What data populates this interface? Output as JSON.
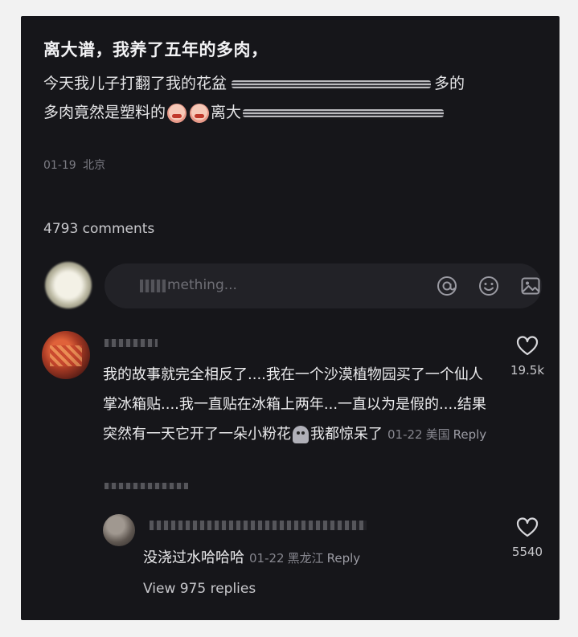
{
  "post": {
    "title": "离大谱，我养了五年的多肉，",
    "body_part1": "今天我儿子打翻了我的花盆",
    "body_part2": "多的",
    "body_part3": "多肉竟然是塑料的",
    "body_part4": "离大",
    "date": "01-19",
    "location": "北京"
  },
  "comments_count": "4793 comments",
  "input": {
    "placeholder_visible": "mething..."
  },
  "comments": [
    {
      "text": "我的故事就完全相反了....我在一个沙漠植物园买了一个仙人掌冰箱贴....我一直贴在冰箱上两年...一直以为是假的....结果突然有一天它开了一朵小粉花",
      "text_after_emoji": "我都惊呆了",
      "date": "01-22",
      "location": "美国",
      "reply_label": "Reply",
      "likes": "19.5k"
    }
  ],
  "reply": {
    "text": "没浇过水哈哈哈",
    "date": "01-22",
    "location": "黑龙江",
    "reply_label": "Reply",
    "likes": "5540"
  },
  "view_replies": "View 975 replies",
  "icons": {
    "at": "at-icon",
    "emoji": "emoji-icon",
    "image": "image-icon",
    "heart": "heart-icon"
  }
}
